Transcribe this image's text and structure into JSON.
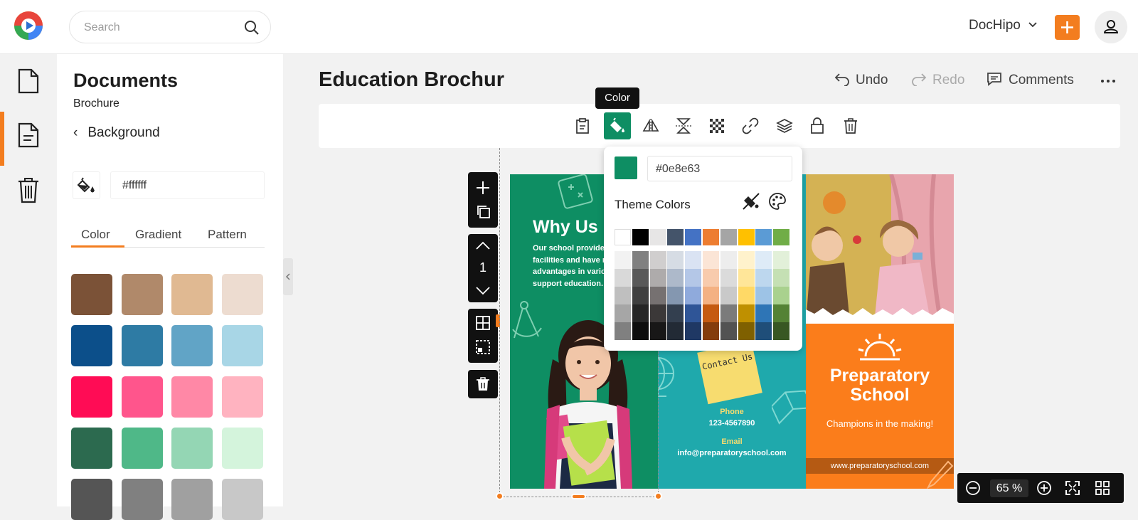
{
  "topbar": {
    "search_placeholder": "Search",
    "brand": "DocHipo"
  },
  "sidebar": {
    "title": "Documents",
    "subtitle": "Brochure",
    "back_label": "Background",
    "hex_value": "#ffffff",
    "tabs": [
      "Color",
      "Gradient",
      "Pattern"
    ],
    "active_tab": "Color",
    "swatches": [
      [
        "#7b5237",
        "#b0896a",
        "#e0b992",
        "#eddcd0"
      ],
      [
        "#0c4f8a",
        "#2e7ba4",
        "#61a4c6",
        "#a8d6e6"
      ],
      [
        "#ff0c55",
        "#ff558c",
        "#ff88a6",
        "#ffb3c0"
      ],
      [
        "#2c6a4f",
        "#4fb888",
        "#94d6b4",
        "#d4f4dc"
      ],
      [
        "#555555",
        "#808080",
        "#a0a0a0",
        "#c8c8c8"
      ]
    ]
  },
  "header": {
    "doc_title": "Education Brochure",
    "undo": "Undo",
    "redo": "Redo",
    "comments": "Comments"
  },
  "toolbar": {
    "tooltip": "Color",
    "active_color": "#0e8e63"
  },
  "canvas_controls": {
    "page_number": "1"
  },
  "brochure": {
    "panel1": {
      "heading": "Why Us",
      "body": "Our school provides good facilities and have many advantages in various fields to support education."
    },
    "panel2": {
      "sticky": "Contact Us",
      "phone_label": "Phone",
      "phone": "123-4567890",
      "email_label": "Email",
      "email": "info@preparatoryschool.com"
    },
    "panel3": {
      "title": "Preparatory School",
      "tagline": "Champions in the making!",
      "url": "www.preparatoryschool.com"
    }
  },
  "color_popup": {
    "hex_value": "#0e8e63",
    "theme_label": "Theme Colors",
    "top_row": [
      "#ffffff",
      "#000000",
      "#e7e6e6",
      "#44546a",
      "#4472c4",
      "#ed7d31",
      "#a5a5a5",
      "#ffc000",
      "#5b9bd5",
      "#70ad47"
    ],
    "shade_columns": [
      [
        "#f2f2f2",
        "#d9d9d9",
        "#bfbfbf",
        "#a6a6a6",
        "#808080"
      ],
      [
        "#808080",
        "#595959",
        "#404040",
        "#262626",
        "#0d0d0d"
      ],
      [
        "#d0cece",
        "#aeabab",
        "#767171",
        "#3b3838",
        "#181717"
      ],
      [
        "#d6dce4",
        "#adb9ca",
        "#8497b0",
        "#333f4f",
        "#222a35"
      ],
      [
        "#dae3f3",
        "#b4c7e7",
        "#8faadc",
        "#2f5597",
        "#1f3864"
      ],
      [
        "#fbe5d6",
        "#f8cbad",
        "#f4b183",
        "#c55a11",
        "#843c0c"
      ],
      [
        "#ededed",
        "#dbdbdb",
        "#c9c9c9",
        "#7b7b7b",
        "#525252"
      ],
      [
        "#fff2cc",
        "#ffe699",
        "#ffd966",
        "#bf9000",
        "#7f6000"
      ],
      [
        "#deebf7",
        "#bdd7ee",
        "#9dc3e6",
        "#2e75b6",
        "#1f4e79"
      ],
      [
        "#e2f0d9",
        "#c5e0b4",
        "#a9d18e",
        "#548235",
        "#385723"
      ]
    ]
  },
  "zoom": {
    "value": "65",
    "unit": "%"
  }
}
